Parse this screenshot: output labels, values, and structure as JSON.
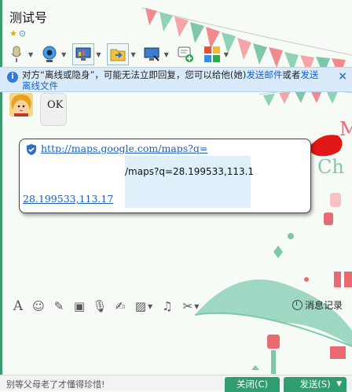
{
  "window": {
    "title": "测试号"
  },
  "notice": {
    "text_before": "对方“离线或隐身”，可能无法立即回复，您可以给他(她)",
    "link_mail": "发送邮件",
    "text_mid": "或者",
    "link_file_1": "发送",
    "link_file_2": "离线文件",
    "close": "×"
  },
  "messages": [
    {
      "text": "OK"
    },
    {
      "link_line1": "http://maps.google.com/maps?q=",
      "preview_text": "/maps?q=28.199533,113.1",
      "link_line2": "28.199533,113.17"
    }
  ],
  "history_label": "消息记录",
  "footer": {
    "motto": "别等父母老了才懂得珍惜!",
    "close_label": "关闭(C)",
    "send_label": "发送(S)"
  },
  "decor": {
    "letters_1": "M",
    "letters_2": "Ch"
  },
  "colors": {
    "accent": "#2f9d6e",
    "link": "#1d5fbf",
    "notice_bg": "#d9ebfa"
  }
}
